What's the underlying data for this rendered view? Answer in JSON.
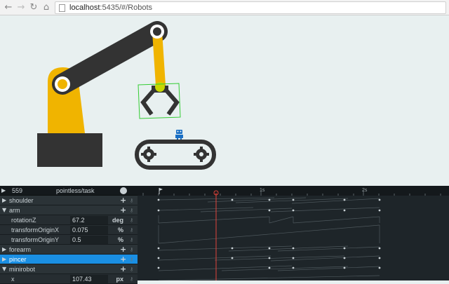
{
  "browser": {
    "url_host": "localhost",
    "url_rest": ":5435/#/Robots",
    "back_icon": "back-arrow-icon",
    "forward_icon": "forward-arrow-icon",
    "reload_icon": "reload-icon",
    "home_icon": "home-icon"
  },
  "stage": {
    "background": "#e8f0f0",
    "arm_color": "#f0b400",
    "dark_color": "#333333",
    "selection_color": "#33cc33",
    "minirobot_color": "#1a6fc4"
  },
  "panel": {
    "frame": "559",
    "project": "pointless/task",
    "timeline_marks": [
      "1s",
      "2s"
    ],
    "playhead_color": "#e0443a",
    "selected_color": "#1a8fe3"
  },
  "tree": [
    {
      "label": "shoulder",
      "type": "group",
      "open": false
    },
    {
      "label": "arm",
      "type": "group",
      "open": true
    },
    {
      "label": "rotationZ",
      "type": "prop",
      "value": "67.2",
      "unit": "deg"
    },
    {
      "label": "transformOriginX",
      "type": "prop",
      "value": "0.075",
      "unit": "%"
    },
    {
      "label": "transformOriginY",
      "type": "prop",
      "value": "0.5",
      "unit": "%"
    },
    {
      "label": "forearm",
      "type": "group",
      "open": false
    },
    {
      "label": "pincer",
      "type": "group",
      "open": false,
      "selected": true
    },
    {
      "label": "minirobot",
      "type": "group",
      "open": true
    },
    {
      "label": "x",
      "type": "prop",
      "value": "107.43",
      "unit": "px"
    }
  ]
}
